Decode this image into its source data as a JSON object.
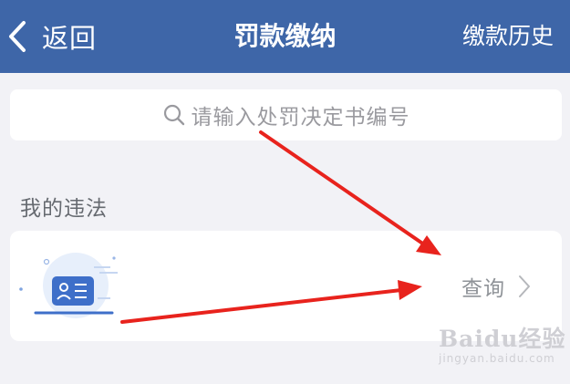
{
  "nav": {
    "back_label": "返回",
    "title": "罚款缴纳",
    "history_label": "缴款历史"
  },
  "search": {
    "placeholder": "请输入处罚决定书编号"
  },
  "section": {
    "title": "我的违法"
  },
  "violation_card": {
    "query_label": "查询"
  },
  "watermark": {
    "brand": "Baidu经验",
    "url": "jingyan.baidu.com"
  },
  "colors": {
    "nav_bg": "#3e66a8",
    "page_bg": "#f2f2f6",
    "annotation_arrow": "#e8231d"
  }
}
